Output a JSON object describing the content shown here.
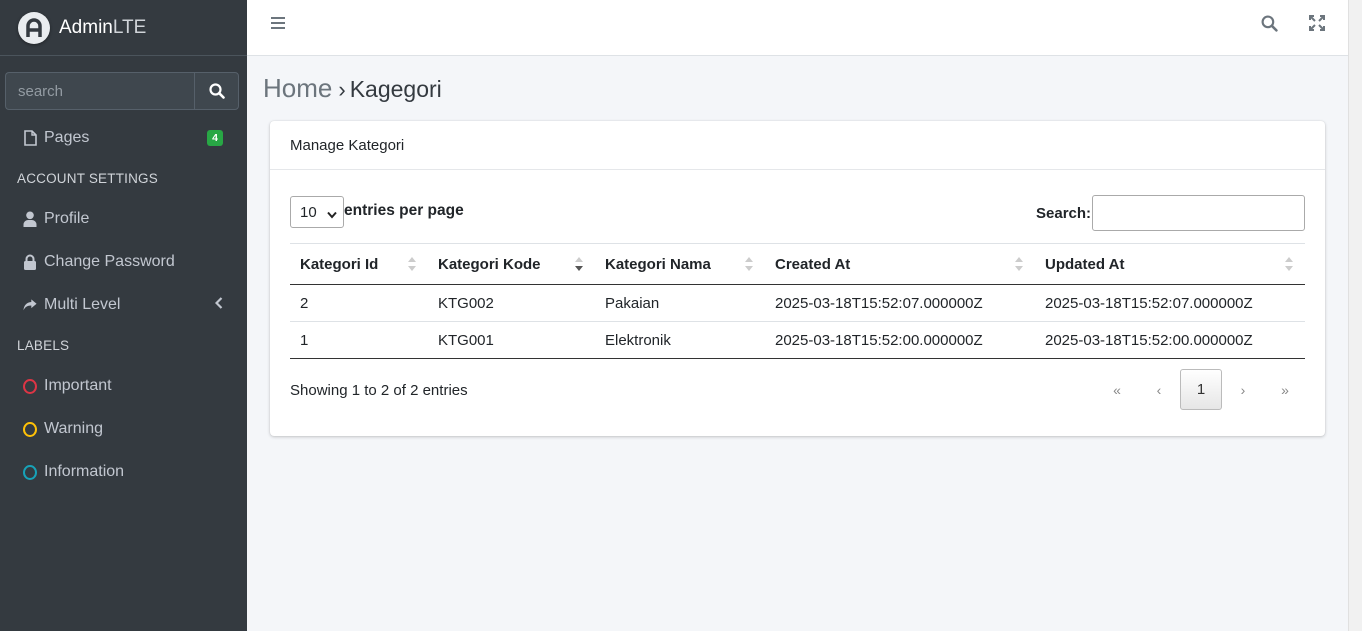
{
  "brand": {
    "name_bold": "Admin",
    "name_light": "LTE"
  },
  "sidebar": {
    "search_placeholder": "search",
    "pages": {
      "label": "Pages",
      "badge": "4"
    },
    "account_header": "ACCOUNT SETTINGS",
    "profile": "Profile",
    "change_password": "Change Password",
    "multi_level": "Multi Level",
    "labels_header": "LABELS",
    "labels": [
      {
        "label": "Important",
        "color": "#dc3545"
      },
      {
        "label": "Warning",
        "color": "#ffc107"
      },
      {
        "label": "Information",
        "color": "#17a2b8"
      }
    ]
  },
  "breadcrumb": {
    "home": "Home",
    "separator": "›",
    "current": "Kagegori"
  },
  "card": {
    "title": "Manage Kategori",
    "page_size": "10",
    "entries_label": "entries per page",
    "search_label": "Search:",
    "columns": [
      "Kategori Id",
      "Kategori Kode",
      "Kategori Nama",
      "Created At",
      "Updated At"
    ],
    "rows": [
      [
        "2",
        "KTG002",
        "Pakaian",
        "2025-03-18T15:52:07.000000Z",
        "2025-03-18T15:52:07.000000Z"
      ],
      [
        "1",
        "KTG001",
        "Elektronik",
        "2025-03-18T15:52:00.000000Z",
        "2025-03-18T15:52:00.000000Z"
      ]
    ],
    "info": "Showing 1 to 2 of 2 entries",
    "pagination": {
      "first": "«",
      "prev": "‹",
      "current": "1",
      "next": "›",
      "last": "»"
    }
  }
}
